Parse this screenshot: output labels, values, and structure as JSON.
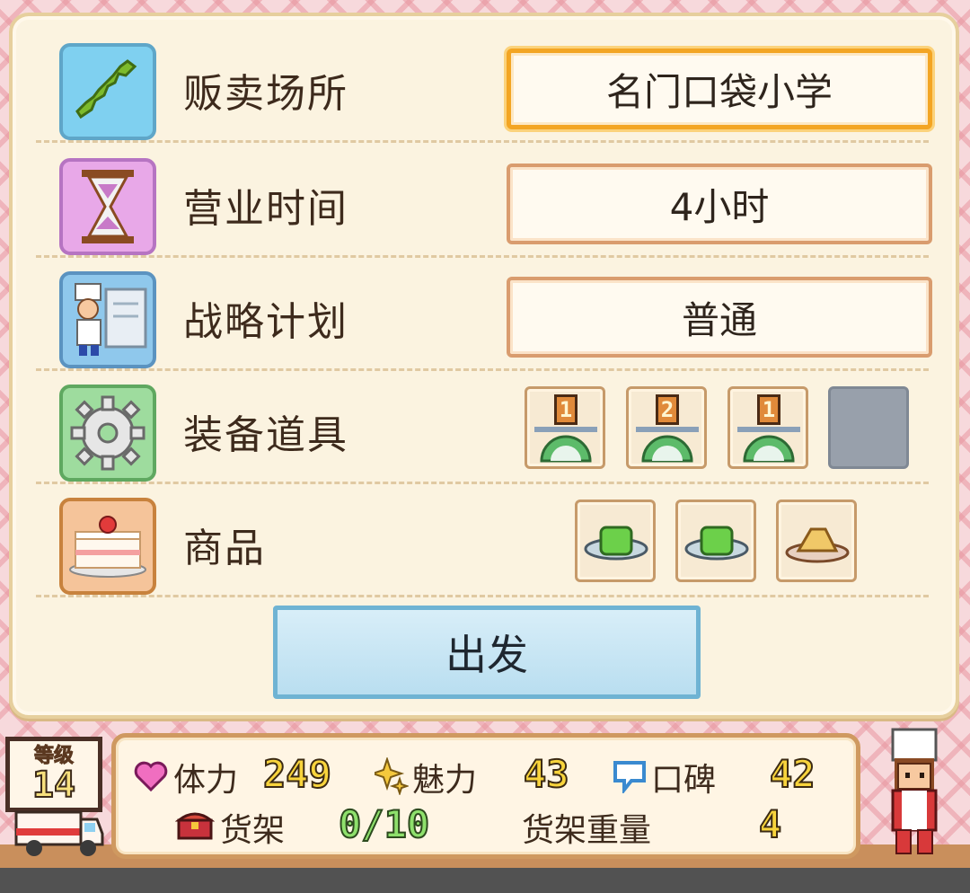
{
  "rows": [
    {
      "label": "贩卖场所",
      "value": "名门口袋小学",
      "icon": "japan-map-icon",
      "icon_bg": "#7fd0f0"
    },
    {
      "label": "营业时间",
      "value": "4小时",
      "icon": "hourglass-icon",
      "icon_bg": "#e8a8e8"
    },
    {
      "label": "战略计划",
      "value": "普通",
      "icon": "chef-strategy-icon",
      "icon_bg": "#8fc8ec"
    },
    {
      "label": "装备道具",
      "icon": "gear-icon",
      "icon_bg": "#9edc9e"
    },
    {
      "label": "商品",
      "icon": "cake-icon",
      "icon_bg": "#f5c49a"
    }
  ],
  "equipment": [
    {
      "level": "1",
      "icon": "scale-icon"
    },
    {
      "level": "2",
      "icon": "scale-icon"
    },
    {
      "level": "1",
      "icon": "scale-icon"
    },
    {
      "level": "",
      "icon": "empty-slot"
    }
  ],
  "products": [
    {
      "icon": "green-dish-icon"
    },
    {
      "icon": "green-dish-icon"
    },
    {
      "icon": "pastry-dish-icon"
    }
  ],
  "depart_button": "出发",
  "hud": {
    "level_label": "等级",
    "level": "14",
    "stamina_label": "体力",
    "stamina": "249",
    "charm_label": "魅力",
    "charm": "43",
    "reputation_label": "口碑",
    "reputation": "42",
    "shelf_label": "货架",
    "shelf": "0/10",
    "shelf_weight_label": "货架重量",
    "shelf_weight": "4"
  },
  "colors": {
    "accent": "#f3a523",
    "button": "#6fb3d3",
    "panel": "#fbf3e0"
  }
}
